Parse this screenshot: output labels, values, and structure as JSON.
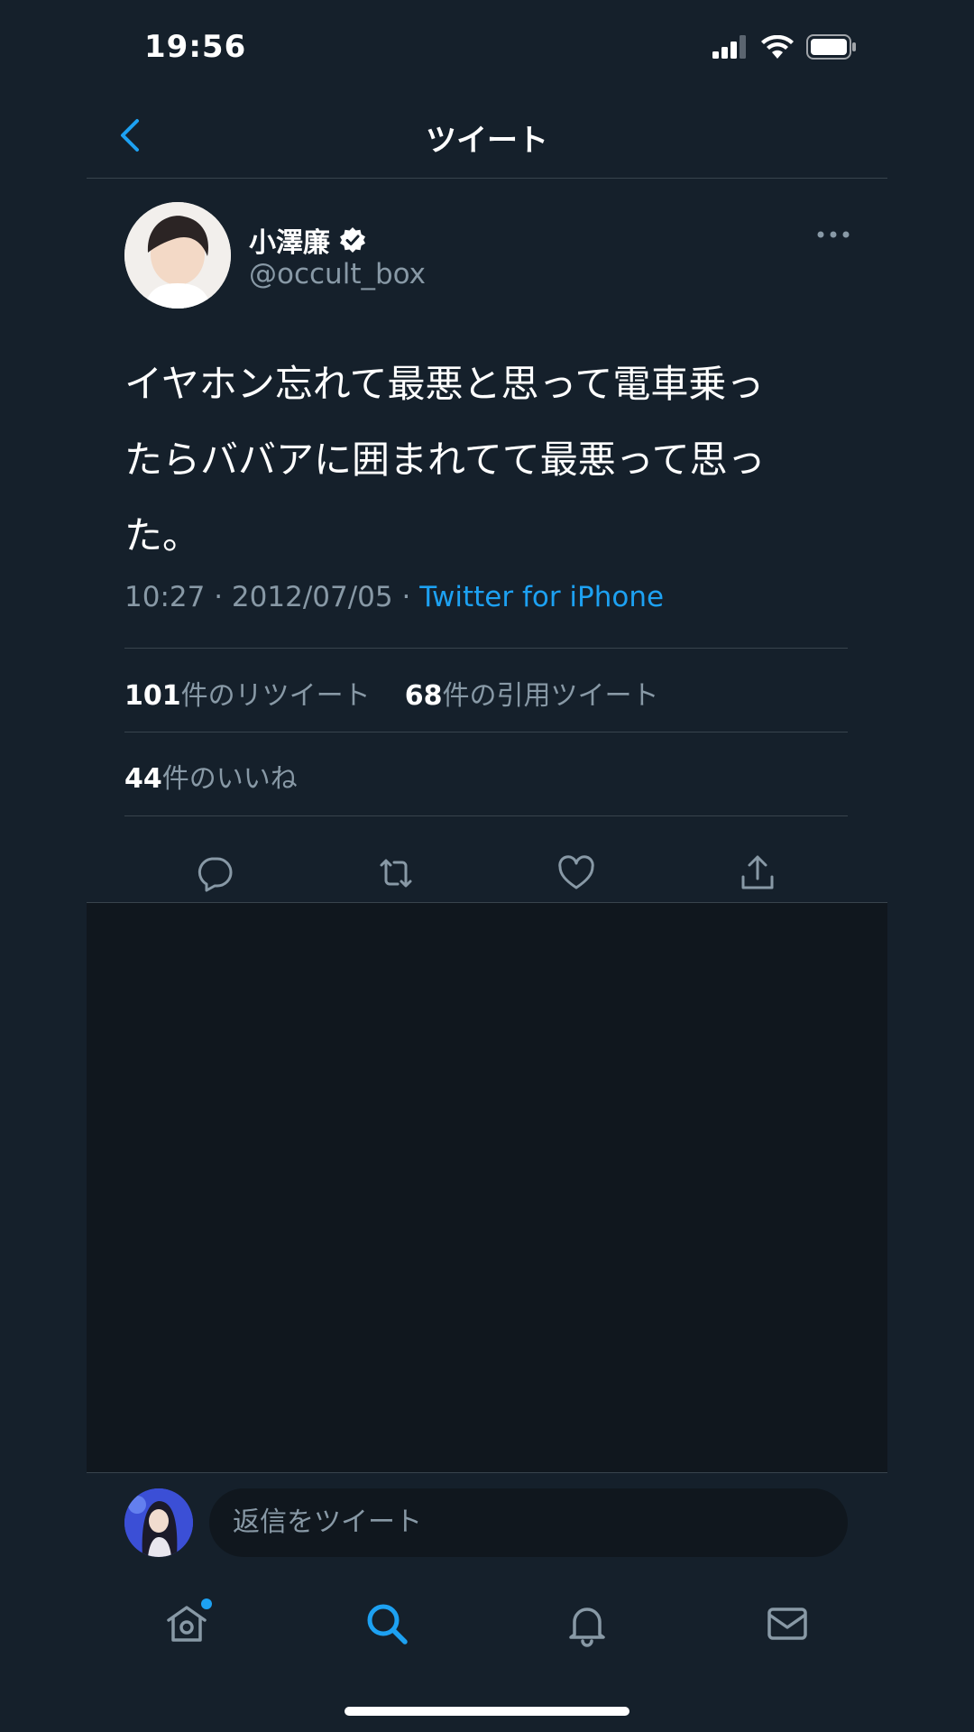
{
  "status_bar": {
    "time": "19:56"
  },
  "header": {
    "title": "ツイート"
  },
  "tweet": {
    "author_name": "小澤廉",
    "author_handle": "@occult_box",
    "text_lines": [
      "イヤホン忘れて最悪と思って電車乗っ",
      "たらババアに囲まれてて最悪って思っ",
      "た。"
    ],
    "time": "10:27",
    "date": "2012/07/05",
    "source": "Twitter for iPhone",
    "retweet_count": "101",
    "retweet_label": "件のリツイート",
    "quote_count": "68",
    "quote_label": "件の引用ツイート",
    "like_count": "44",
    "like_label": "件のいいね"
  },
  "reply": {
    "placeholder": "返信をツイート"
  },
  "icons": {
    "back": "chevron-left-icon",
    "verified": "verified-badge-icon",
    "more": "more-horizontal-icon",
    "reply": "comment-icon",
    "retweet": "retweet-icon",
    "like": "heart-icon",
    "share": "share-icon",
    "tab_home": "home-icon",
    "tab_search": "search-icon",
    "tab_notifications": "bell-icon",
    "tab_messages": "mail-icon"
  },
  "colors": {
    "background": "#15202b",
    "accent": "#1da1f2",
    "secondary_text": "#8899a6",
    "divider": "#38444d"
  }
}
